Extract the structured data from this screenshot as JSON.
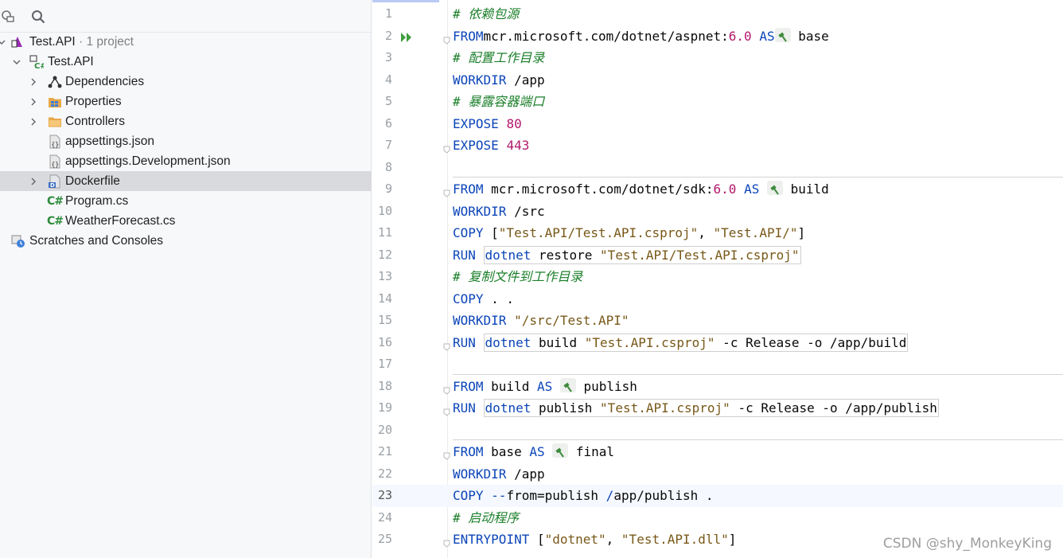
{
  "sidebar": {
    "project_name": "Test.API",
    "project_count": "· 1 project",
    "items": [
      {
        "label": "Test.API"
      },
      {
        "label": "Dependencies"
      },
      {
        "label": "Properties"
      },
      {
        "label": "Controllers"
      },
      {
        "label": "appsettings.json"
      },
      {
        "label": "appsettings.Development.json"
      },
      {
        "label": "Dockerfile"
      },
      {
        "label": "Program.cs"
      },
      {
        "label": "WeatherForecast.cs"
      },
      {
        "label": "Scratches and Consoles"
      }
    ],
    "cs_badge": "C#",
    "json_badge": "{}",
    "docker_badge": "D"
  },
  "editor": {
    "lines": [
      {
        "n": "1",
        "tokens": [
          [
            "cmt",
            "# 依赖包源"
          ]
        ]
      },
      {
        "n": "2",
        "run": true,
        "fold": true,
        "tokens": [
          [
            "kw",
            "FROM"
          ],
          [
            "",
            "mcr.microsoft.com/dotnet/aspnet:"
          ],
          [
            "num",
            "6.0"
          ],
          [
            "",
            " "
          ],
          [
            "kw",
            "AS"
          ],
          [
            "",
            ""
          ],
          [
            "chip",
            ""
          ],
          [
            "",
            " base"
          ]
        ]
      },
      {
        "n": "3",
        "tokens": [
          [
            "cmt",
            "# 配置工作目录"
          ]
        ]
      },
      {
        "n": "4",
        "tokens": [
          [
            "kw",
            "WORKDIR"
          ],
          [
            "",
            " /app"
          ]
        ]
      },
      {
        "n": "5",
        "tokens": [
          [
            "cmt",
            "# 暴露容器端口"
          ]
        ]
      },
      {
        "n": "6",
        "tokens": [
          [
            "kw",
            "EXPOSE"
          ],
          [
            "",
            " "
          ],
          [
            "num",
            "80"
          ]
        ]
      },
      {
        "n": "7",
        "fold": true,
        "tokens": [
          [
            "kw",
            "EXPOSE"
          ],
          [
            "",
            " "
          ],
          [
            "num",
            "443"
          ]
        ]
      },
      {
        "n": "8",
        "tokens": []
      },
      {
        "n": "9",
        "fold": true,
        "tokens": [
          [
            "kw",
            "FROM"
          ],
          [
            "",
            " mcr.microsoft.com/dotnet/sdk:"
          ],
          [
            "num",
            "6.0"
          ],
          [
            "",
            " "
          ],
          [
            "kw",
            "AS"
          ],
          [
            "",
            " "
          ],
          [
            "chip",
            ""
          ],
          [
            "",
            " build"
          ]
        ]
      },
      {
        "n": "10",
        "tokens": [
          [
            "kw",
            "WORKDIR"
          ],
          [
            "",
            " /src"
          ]
        ]
      },
      {
        "n": "11",
        "tokens": [
          [
            "kw",
            "COPY"
          ],
          [
            "",
            " ["
          ],
          [
            "strc",
            "\"Test.API/Test.API.csproj\""
          ],
          [
            "",
            ", "
          ],
          [
            "strc",
            "\"Test.API/\""
          ],
          [
            "",
            "]"
          ]
        ]
      },
      {
        "n": "12",
        "box": true,
        "tokens": [
          [
            "kw",
            "RUN"
          ],
          [
            "",
            ""
          ],
          [
            "kw",
            "dotnet"
          ],
          [
            "",
            " restore "
          ],
          [
            "strc",
            "\"Test.API/Test.API.csproj\""
          ]
        ]
      },
      {
        "n": "13",
        "tokens": [
          [
            "cmt",
            "# 复制文件到工作目录"
          ]
        ]
      },
      {
        "n": "14",
        "tokens": [
          [
            "kw",
            "COPY"
          ],
          [
            "",
            " . ."
          ]
        ]
      },
      {
        "n": "15",
        "tokens": [
          [
            "kw",
            "WORKDIR"
          ],
          [
            "",
            " "
          ],
          [
            "strc",
            "\"/src/Test.API\""
          ]
        ]
      },
      {
        "n": "16",
        "fold": true,
        "box": true,
        "tokens": [
          [
            "kw",
            "RUN"
          ],
          [
            "",
            ""
          ],
          [
            "kw",
            "dotnet"
          ],
          [
            "",
            " build "
          ],
          [
            "strc",
            "\"Test.API.csproj\""
          ],
          [
            "",
            " -c Release -o /app/build"
          ]
        ]
      },
      {
        "n": "17",
        "tokens": []
      },
      {
        "n": "18",
        "fold": true,
        "tokens": [
          [
            "kw",
            "FROM"
          ],
          [
            "",
            " build "
          ],
          [
            "kw",
            "AS"
          ],
          [
            "",
            " "
          ],
          [
            "chip",
            ""
          ],
          [
            "",
            " publish"
          ]
        ]
      },
      {
        "n": "19",
        "fold": true,
        "box": true,
        "tokens": [
          [
            "kw",
            "RUN"
          ],
          [
            "",
            ""
          ],
          [
            "kw",
            "dotnet"
          ],
          [
            "",
            " publish "
          ],
          [
            "strc",
            "\"Test.API.csproj\""
          ],
          [
            "",
            " -c Release -o /app/publish"
          ]
        ]
      },
      {
        "n": "20",
        "tokens": []
      },
      {
        "n": "21",
        "fold": true,
        "tokens": [
          [
            "kw",
            "FROM"
          ],
          [
            "",
            " base "
          ],
          [
            "kw",
            "AS"
          ],
          [
            "",
            " "
          ],
          [
            "chip",
            ""
          ],
          [
            "",
            " final"
          ]
        ]
      },
      {
        "n": "22",
        "tokens": [
          [
            "kw",
            "WORKDIR"
          ],
          [
            "",
            " /app"
          ]
        ]
      },
      {
        "n": "23",
        "current": true,
        "tokens": [
          [
            "kw",
            "COPY"
          ],
          [
            "",
            " "
          ],
          [
            "kw",
            "--"
          ],
          [
            "",
            "from=publish "
          ],
          [
            "kw",
            "/"
          ],
          [
            "",
            "app/publish ."
          ]
        ]
      },
      {
        "n": "24",
        "tokens": [
          [
            "cmt",
            "# 启动程序"
          ]
        ]
      },
      {
        "n": "25",
        "fold": true,
        "tokens": [
          [
            "kw",
            "ENTRYPOINT"
          ],
          [
            "",
            " ["
          ],
          [
            "strc",
            "\"dotnet\""
          ],
          [
            "",
            ", "
          ],
          [
            "strc",
            "\"Test.API.dll\""
          ],
          [
            "",
            "]"
          ]
        ]
      }
    ]
  },
  "watermark": "CSDN @shy_MonkeyKing",
  "colors": {
    "keyword": "#0b45b8",
    "number": "#b2186b",
    "string": "#785818",
    "comment": "#1b7f2a",
    "selection": "#d9dadd"
  }
}
